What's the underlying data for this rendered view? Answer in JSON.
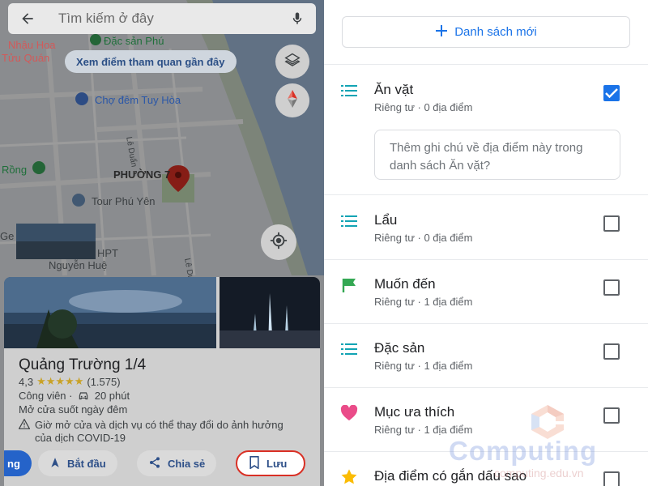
{
  "map": {
    "search_placeholder": "Tìm kiếm ở đây",
    "tour_chip": "Xem điểm tham quan gần đây",
    "labels": {
      "nhau_hoa": "Nhậu Hoa",
      "tuu_quan": "Tửu Quán",
      "dac_san_phu": "Đặc sản Phú",
      "cho_dem": "Chợ đêm Tuy Hòa",
      "rong": "Rồng",
      "phuong7": "PHƯỜNG 7",
      "tour_phu_yen": "Tour Phú Yên",
      "hpt": "HPT",
      "nguyen_hue": "Nguyễn Huệ",
      "ge": "Ge",
      "le_duan_1": "Lê Duẩn",
      "le_duan_2": "Lê Duẩn"
    }
  },
  "card": {
    "name": "Quảng Trường 1/4",
    "rating": "4,3",
    "stars": "★★★★★",
    "reviews": "(1.575)",
    "category": "Công viên ·",
    "drive_time": "20 phút",
    "hours": "Mở cửa suốt ngày đêm",
    "warning": "Giờ mở cửa và dịch vụ có thể thay đổi do ảnh hưởng của dịch COVID-19",
    "actions": {
      "directions": "ng",
      "start": "Bắt đầu",
      "share": "Chia sẻ",
      "save": "Lưu"
    }
  },
  "lists_panel": {
    "new_list": "Danh sách mới",
    "note_placeholder": "Thêm ghi chú về địa điểm này trong danh sách Ăn vặt?",
    "items": [
      {
        "title": "Ăn vặt",
        "sub": "Riêng tư · 0 địa điểm",
        "icon": "list-icon",
        "checked": true
      },
      {
        "title": "Lẩu",
        "sub": "Riêng tư · 0 địa điểm",
        "icon": "list-icon",
        "checked": false
      },
      {
        "title": "Muốn đến",
        "sub": "Riêng tư · 1 địa điểm",
        "icon": "flag-icon",
        "checked": false
      },
      {
        "title": "Đặc sản",
        "sub": "Riêng tư · 1 địa điểm",
        "icon": "list-icon",
        "checked": false
      },
      {
        "title": "Mục ưa thích",
        "sub": "Riêng tư · 1 địa điểm",
        "icon": "heart-icon",
        "checked": false
      },
      {
        "title": "Địa điểm có gắn dấu sao",
        "sub": "",
        "icon": "star-icon",
        "checked": false
      }
    ]
  },
  "watermark": {
    "brand": "Computing",
    "url": "computing.edu.vn"
  },
  "colors": {
    "accent": "#1a73e8",
    "list_icon": "#12a4b4",
    "flag": "#34a853",
    "heart": "#ea4c89",
    "star": "#fbbc04",
    "save_outline": "#d93025"
  }
}
